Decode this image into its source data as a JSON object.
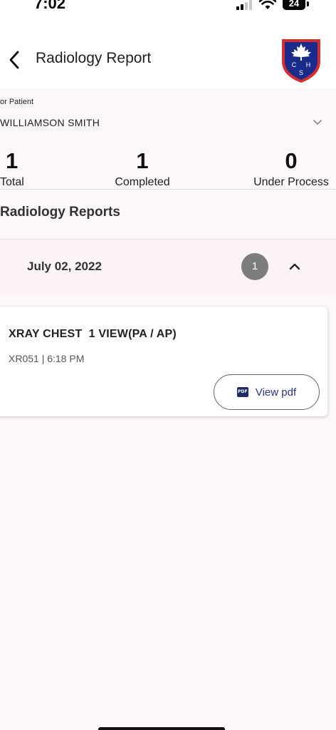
{
  "status_bar": {
    "time": "7:02",
    "battery": "24"
  },
  "header": {
    "title": "Radiology Report",
    "logo_letters": [
      "C",
      "H",
      "S"
    ]
  },
  "patient": {
    "label": "or Patient",
    "name": "WILLIAMSON SMITH"
  },
  "stats": [
    {
      "value": "1",
      "label": "Total"
    },
    {
      "value": "1",
      "label": "Completed"
    },
    {
      "value": "0",
      "label": "Under Process"
    }
  ],
  "section": {
    "title": "Radiology Reports"
  },
  "group": {
    "date": "July 02, 2022",
    "count": "1"
  },
  "report": {
    "name": "XRAY CHEST  1 VIEW(PA / AP)",
    "meta": "XR051 | 6:18 PM",
    "button_label": "View pdf",
    "pdf_icon_text": "PDF"
  },
  "colors": {
    "background": "#fdf7fb",
    "badge": "#7d7d7d",
    "link_blue": "#283593",
    "logo_blue": "#1a2b8c",
    "logo_red": "#d32f2f"
  }
}
